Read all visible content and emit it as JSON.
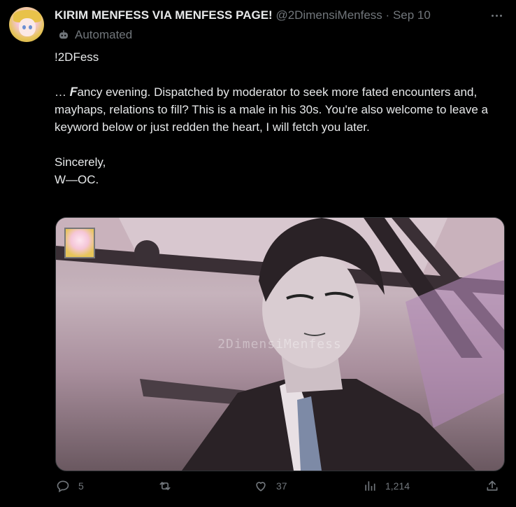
{
  "author": {
    "name": "KIRIM MENFESS VIA MENFESS PAGE!",
    "handle": "@2DimensiMenfess",
    "separator": "·",
    "date": "Sep 10",
    "label": "Automated"
  },
  "post": {
    "line1": "!2DFess",
    "paragraph": "… 𝑭ancy evening. Dispatched by moderator to seek more fated encounters and, mayhaps, relations to fill? This is a male in his 30s. You're also welcome to leave a keyword below or just redden the heart, I will fetch you later.",
    "closing1": "Sincerely,",
    "closing2": "W—OC."
  },
  "media": {
    "watermark": "2DimensiMenfess"
  },
  "actions": {
    "replies": "5",
    "reposts": "",
    "likes": "37",
    "views": "1,214"
  },
  "icons": {
    "more": "more-horizontal-icon",
    "automated": "bot-icon",
    "reply": "reply-icon",
    "repost": "repost-icon",
    "like": "heart-icon",
    "views": "analytics-icon",
    "share": "share-icon"
  }
}
